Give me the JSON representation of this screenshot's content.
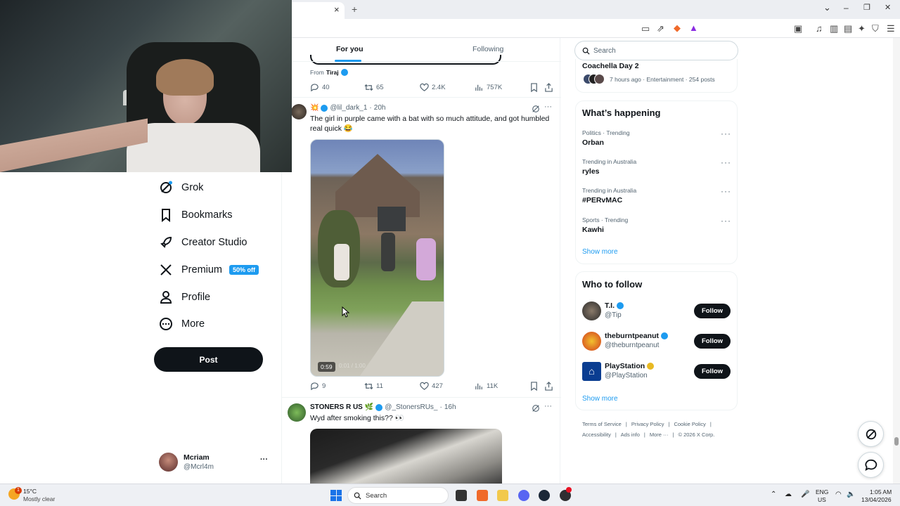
{
  "browser": {
    "new_tab_symbol": "+",
    "tab_close": "×",
    "window_controls": [
      "⌄",
      "–",
      "❐",
      "✕"
    ]
  },
  "timeline_tabs": [
    {
      "label": "For you",
      "active": true
    },
    {
      "label": "Following",
      "active": false
    }
  ],
  "nav": {
    "items": [
      {
        "label": "Grok",
        "icon": "grok-icon"
      },
      {
        "label": "Bookmarks",
        "icon": "bookmark-icon"
      },
      {
        "label": "Creator Studio",
        "icon": "rocket-icon"
      },
      {
        "label": "Premium",
        "icon": "x-logo-icon",
        "badge": "50% off"
      },
      {
        "label": "Profile",
        "icon": "person-icon"
      },
      {
        "label": "More",
        "icon": "more-circle-icon"
      }
    ],
    "post_label": "Post"
  },
  "account": {
    "name": "Mcriam",
    "handle": "@Mcrl4m",
    "more": "···"
  },
  "tweet0": {
    "from_prefix": "From",
    "from_name": "Tiraj",
    "replies": "40",
    "reposts": "65",
    "likes": "2.4K",
    "views": "757K"
  },
  "tweet1": {
    "handle_emoji": "💥",
    "handle": "@lil_dark_1",
    "time": "20h",
    "text": "The girl in purple came with a bat with so much attitude, and got humbled real quick 😂",
    "video_time": "0:59",
    "video_overlay": "0:01 / 1:00",
    "replies": "9",
    "reposts": "11",
    "likes": "427",
    "views": "11K"
  },
  "tweet2": {
    "name": "STONERS R US",
    "name_emoji": "🌿",
    "handle": "@_StonersRUs_",
    "time": "16h",
    "text": "Wyd after smoking this?? 👀"
  },
  "right": {
    "search_placeholder": "Search",
    "coachella": {
      "title": "Coachella Day 2",
      "meta": "7 hours ago · Entertainment · 254 posts"
    },
    "whats_happening": {
      "title": "What’s happening",
      "trends": [
        {
          "context": "Politics · Trending",
          "name": "Orban"
        },
        {
          "context": "Trending in Australia",
          "name": "ryles"
        },
        {
          "context": "Trending in Australia",
          "name": "#PERvMAC"
        },
        {
          "context": "Sports · Trending",
          "name": "Kawhi"
        }
      ],
      "show_more": "Show more"
    },
    "who_to_follow": {
      "title": "Who to follow",
      "accounts": [
        {
          "name": "T.I.",
          "handle": "@Tip",
          "verified": "blue",
          "button": "Follow"
        },
        {
          "name": "theburntpeanut",
          "handle": "@theburntpeanut",
          "verified": "blue",
          "button": "Follow"
        },
        {
          "name": "PlayStation",
          "handle": "@PlayStation",
          "verified": "gold",
          "button": "Follow"
        }
      ],
      "show_more": "Show more"
    },
    "footer": {
      "links": [
        "Terms of Service",
        "Privacy Policy",
        "Cookie Policy",
        "Accessibility",
        "Ads info",
        "More ···"
      ],
      "copyright": "© 2026 X Corp.",
      "separator": "|"
    }
  },
  "taskbar": {
    "weather_temp": "15°C",
    "weather_desc": "Mostly clear",
    "weather_alert": "1",
    "search_label": "Search",
    "lang_top": "ENG",
    "lang_bottom": "US",
    "time": "1:05 AM",
    "date": "13/04/2026",
    "notification_count": "1"
  },
  "colors": {
    "accent": "#1d9bf0",
    "text": "#0f1419",
    "muted": "#536471",
    "premium_badge": "#1d9bf0"
  }
}
